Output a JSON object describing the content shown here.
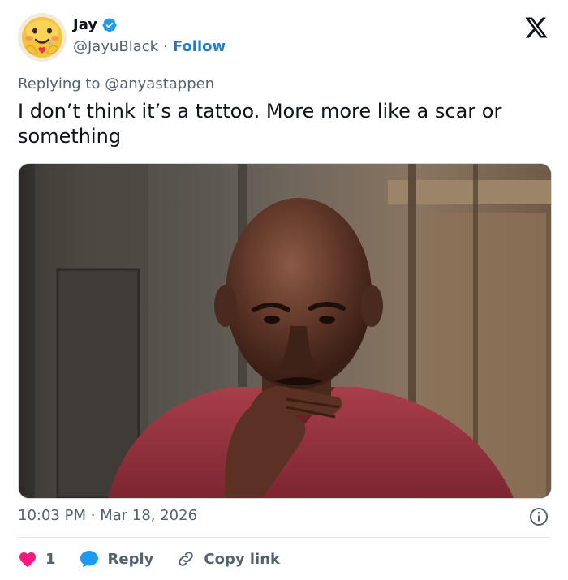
{
  "author": {
    "name": "Jay",
    "handle": "@JayuBlack",
    "separator": "·",
    "follow_label": "Follow",
    "verified": true,
    "avatar_icon": "blushing-emoji-avatar"
  },
  "reply": {
    "prefix": "Replying to",
    "mention": "@anyastappen"
  },
  "tweet": {
    "text": "I don’t think it’s a tattoo. More more like a scar or something",
    "media_alt": "photo of a bald man with his hand on his chin in front of a wooden shack"
  },
  "meta": {
    "time": "10:03 PM",
    "separator": "·",
    "date": "Mar 18, 2026"
  },
  "actions": {
    "like_count": "1",
    "reply_label": "Reply",
    "copy_link_label": "Copy link"
  },
  "colors": {
    "brand_blue": "#1d9bf0",
    "like_pink": "#f91880",
    "text_secondary": "#536471"
  }
}
